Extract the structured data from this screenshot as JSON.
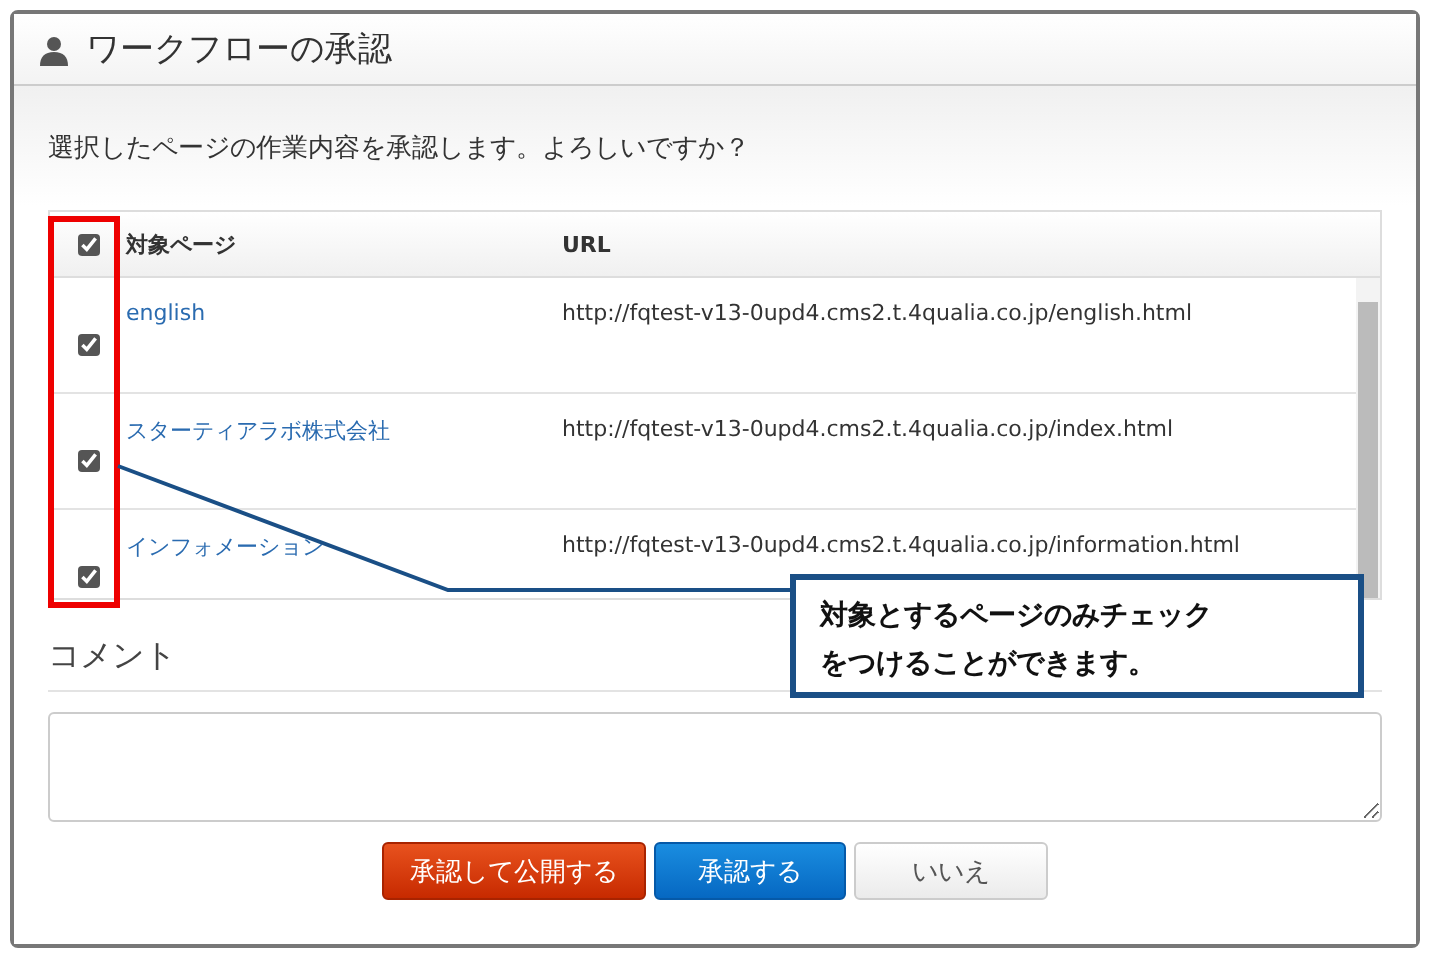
{
  "window": {
    "title": "ワークフローの承認"
  },
  "message": "選択したページの作業内容を承認します。よろしいですか？",
  "table": {
    "header_checked": true,
    "columns": [
      "対象ページ",
      "URL"
    ],
    "rows": [
      {
        "checked": true,
        "page": "english",
        "url": "http://fqtest-v13-0upd4.cms2.t.4qualia.co.jp/english.html"
      },
      {
        "checked": true,
        "page": "スターティアラボ株式会社",
        "url": "http://fqtest-v13-0upd4.cms2.t.4qualia.co.jp/index.html"
      },
      {
        "checked": true,
        "page": "インフォメーション",
        "url": "http://fqtest-v13-0upd4.cms2.t.4qualia.co.jp/information.html"
      }
    ]
  },
  "comment": {
    "label": "コメント"
  },
  "buttons": [
    {
      "kind": "danger",
      "label": "承認して公開する"
    },
    {
      "kind": "primary",
      "label": "承認する"
    },
    {
      "kind": "default",
      "label": "いいえ"
    }
  ],
  "callout": {
    "lines": [
      "対象とするページのみチェック",
      "をつけることができます。"
    ]
  }
}
